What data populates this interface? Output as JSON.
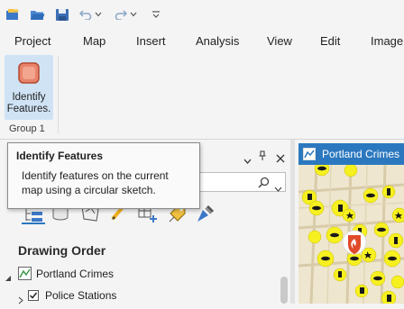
{
  "menu": {
    "items": [
      "Project",
      "Map",
      "Insert",
      "Analysis",
      "View",
      "Edit",
      "Image"
    ]
  },
  "ribbon": {
    "tool_label_line1": "Identify",
    "tool_label_line2": "Features.",
    "group_label": "Group 1"
  },
  "tooltip": {
    "title": "Identify Features",
    "line1": "Identify features on the current",
    "line2": "map using a circular sketch."
  },
  "contents": {
    "section_title": "Drawing Order",
    "map_name": "Portland Crimes",
    "layer_1": "Police Stations"
  },
  "map_view": {
    "tab_title": "Portland Crimes"
  },
  "colors": {
    "accent_blue": "#2b78bf",
    "selected_tool_bg": "#cfe3f5",
    "crime_marker_yellow": "#f7f020",
    "station_marker_red": "#e04a2a"
  }
}
